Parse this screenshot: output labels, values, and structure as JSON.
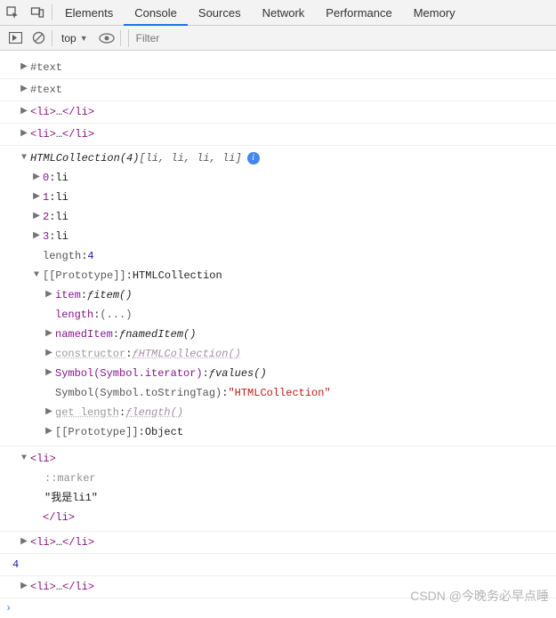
{
  "tabs": {
    "elements": "Elements",
    "console": "Console",
    "sources": "Sources",
    "network": "Network",
    "performance": "Performance",
    "memory": "Memory"
  },
  "toolbar": {
    "context": "top",
    "filter_placeholder": "Filter"
  },
  "rows": {
    "text1": "#text",
    "text2": "#text",
    "li_open": "<li>",
    "li_ellipsis": "…",
    "li_close": "</li>"
  },
  "hc": {
    "header_a": "HTMLCollection(4)",
    "header_preview": " [li, li, li, li]",
    "idx0": "0",
    "idx1": "1",
    "idx2": "2",
    "idx3": "3",
    "li_val": "li",
    "length_key": "length",
    "length_val": "4",
    "proto_key": "[[Prototype]]",
    "proto_val": "HTMLCollection",
    "item_key": "item",
    "item_val": "item()",
    "length2_key": "length",
    "length2_val": "(...)",
    "named_key": "namedItem",
    "named_val": "namedItem()",
    "ctor_key": "constructor",
    "ctor_val": "HTMLCollection()",
    "sym_iter_key": "Symbol(Symbol.iterator)",
    "sym_iter_val": "values()",
    "sym_tag_key": "Symbol(Symbol.toStringTag)",
    "sym_tag_val": "\"HTMLCollection\"",
    "get_len_key": "get length",
    "get_len_val": "length()",
    "proto2_val": "Object",
    "f": "ƒ"
  },
  "expanded_li": {
    "open": "<li>",
    "marker": "::marker",
    "content": "\"我是li1\"",
    "close": "</li>"
  },
  "num_row": "4",
  "watermark": "CSDN @今晚务必早点睡"
}
